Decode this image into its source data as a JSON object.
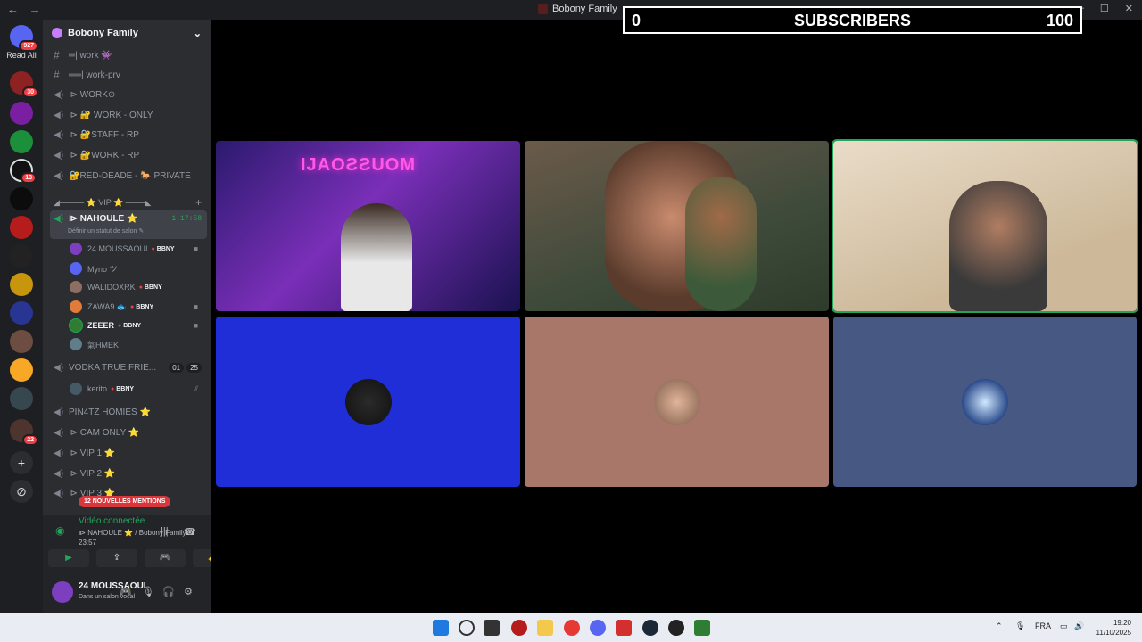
{
  "window": {
    "title": "Bobony Family",
    "back_label": "←",
    "forward_label": "→",
    "minimize": "—",
    "maximize": "☐",
    "close": "✕"
  },
  "server_rail": {
    "read_all": "Read All",
    "top_badge": "927",
    "badges": [
      "30",
      "13",
      "22"
    ],
    "add_label": "+",
    "explore_label": "⊘"
  },
  "server": {
    "name": "Bobony Family",
    "chevron": "⌄"
  },
  "channels": [
    {
      "label": "═| work 👾"
    },
    {
      "label": "══| work-prv"
    },
    {
      "label": "⧐ WORK⊙"
    },
    {
      "label": "⧐ 🔐 WORK - ONLY"
    },
    {
      "label": "⧐ 🔐STAFF - RP"
    },
    {
      "label": "⧐ 🔐WORK - RP"
    },
    {
      "label": "🔐RED-DEADE - 🐎 PRIVATE"
    }
  ],
  "vip_category": "◢━━━━━ ⭐ VIP ⭐ ━━━━◣",
  "active_channel": {
    "label": "⧐ NAHOULE ⭐",
    "timer": "1:17:58",
    "status": "Définir un statut de salon ✎"
  },
  "members": [
    {
      "name": "24 MOUSSAOUI",
      "tag": "BBNY",
      "cam": "■",
      "color": "#7b3fbf"
    },
    {
      "name": "Myno ツ",
      "tag": "",
      "cam": "",
      "color": "#5865f2"
    },
    {
      "name": "WALIDOXRK",
      "tag": "BBNY",
      "cam": "",
      "color": "#8d6e63"
    },
    {
      "name": "ZAWA9 🐟",
      "tag": "BBNY",
      "cam": "■",
      "color": "#e07b39"
    },
    {
      "name": "ZEEER",
      "tag": "BBNY",
      "cam": "■",
      "color": "#2e7d32"
    },
    {
      "name": "氣HMEK",
      "tag": "",
      "cam": "",
      "color": "#607d8b"
    }
  ],
  "vodka_channel": {
    "label": "VODKA TRUE FRIE...",
    "count_a": "01",
    "count_b": "25"
  },
  "vodka_member": {
    "name": "kerito",
    "tag": "BBNY",
    "icon": "⫽"
  },
  "more_channels": [
    {
      "label": "PIN4TZ HOMIES ⭐"
    },
    {
      "label": "⧐ CAM ONLY ⭐"
    },
    {
      "label": "⧐ VIP 1 ⭐"
    },
    {
      "label": "⧐ VIP 2 ⭐"
    },
    {
      "label": "⧐ VIP 3 ⭐"
    }
  ],
  "mentions_pill": "12 NOUVELLES MENTIONS",
  "voice_panel": {
    "status": "Vidéo connectée",
    "channel": "⧐ NAHOULE ⭐ / Bobony Family",
    "time": "23:57",
    "buttons": [
      "▶",
      "⇪",
      "🎮",
      "✨"
    ]
  },
  "user": {
    "name": "24 MOUSSAOUI",
    "status": "Dans un salon vocal"
  },
  "overlay": {
    "left_count": "0",
    "label": "SUBSCRIBERS",
    "right_count": "100"
  },
  "stream_tiles": [
    {
      "neon_text": "IJAOƧƧUOM"
    }
  ],
  "taskbar": {
    "lang": "FRA",
    "time": "19:20",
    "date": "11/10/2025",
    "chevron": "⌃"
  },
  "colors": {
    "rail": "#1e1f22",
    "sidebar": "#2b2d31",
    "accent_green": "#23a559",
    "tile_blue": "#1f2ed6",
    "tile_tan": "#a9776a",
    "tile_slate": "#475883"
  }
}
